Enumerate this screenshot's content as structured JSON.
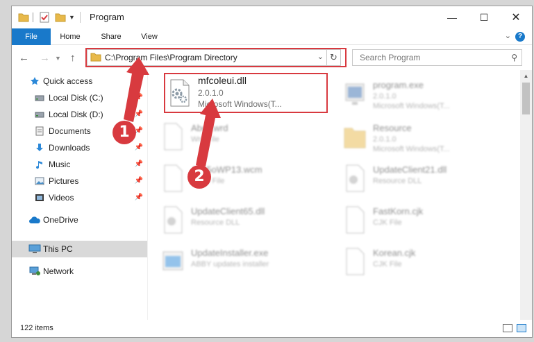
{
  "window": {
    "title": "Program",
    "minimize": "—",
    "maximize": "☐",
    "close": "✕"
  },
  "ribbon": {
    "file": "File",
    "home": "Home",
    "share": "Share",
    "view": "View",
    "help": "?"
  },
  "address": {
    "path": "C:\\Program Files\\Program Directory"
  },
  "search": {
    "placeholder": "Search Program"
  },
  "sidebar": {
    "items": [
      {
        "label": "Quick access",
        "icon": "star-icon"
      },
      {
        "label": "Local Disk (C:)",
        "icon": "drive-icon"
      },
      {
        "label": "Local Disk (D:)",
        "icon": "drive-icon"
      },
      {
        "label": "Documents",
        "icon": "documents-icon"
      },
      {
        "label": "Downloads",
        "icon": "download-icon"
      },
      {
        "label": "Music",
        "icon": "music-icon"
      },
      {
        "label": "Pictures",
        "icon": "pictures-icon"
      },
      {
        "label": "Videos",
        "icon": "videos-icon"
      },
      {
        "label": "OneDrive",
        "icon": "cloud-icon"
      },
      {
        "label": "This PC",
        "icon": "computer-icon"
      },
      {
        "label": "Network",
        "icon": "network-icon"
      }
    ]
  },
  "focus_file": {
    "name": "mfcoleui.dll",
    "version": "2.0.1.0",
    "company": "Microsoft Windows(T..."
  },
  "files": [
    {
      "name": "program.exe",
      "l2": "2.0.1.0",
      "l3": "Microsoft Windows(T..."
    },
    {
      "name": "Abcc.wrd",
      "l2": "Wrd File",
      "l3": ""
    },
    {
      "name": "Resource",
      "l2": "2.0.1.0",
      "l3": "Microsoft Windows(T..."
    },
    {
      "name": "Abc5oWP13.wcm",
      "l2": "WCM File",
      "l3": ""
    },
    {
      "name": "UpdateClient21.dll",
      "l2": "Resource DLL",
      "l3": ""
    },
    {
      "name": "UpdateClient65.dll",
      "l2": "Resource DLL",
      "l3": ""
    },
    {
      "name": "FastKorn.cjk",
      "l2": "CJK File",
      "l3": ""
    },
    {
      "name": "UpdateInstaller.exe",
      "l2": "ABBY updates installer",
      "l3": ""
    },
    {
      "name": "Korean.cjk",
      "l2": "CJK File",
      "l3": ""
    }
  ],
  "status": {
    "count": "122 items"
  },
  "annotations": {
    "one": "1",
    "two": "2"
  },
  "colors": {
    "accent": "#1979ca",
    "highlight": "#d8393f",
    "folder": "#e8b94a"
  }
}
